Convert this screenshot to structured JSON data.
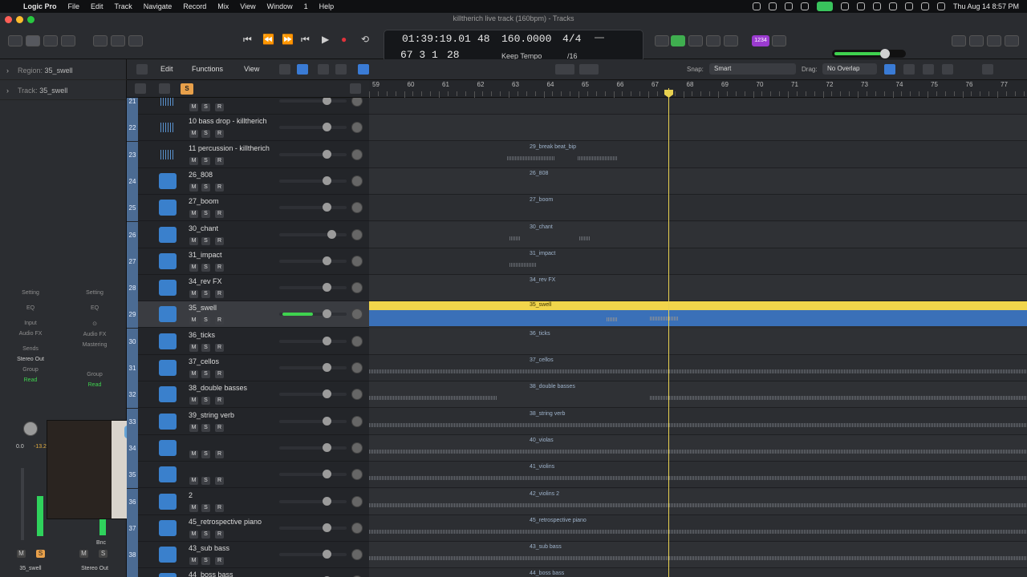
{
  "menubar": {
    "app": "Logic Pro",
    "items": [
      "File",
      "Edit",
      "Track",
      "Navigate",
      "Record",
      "Mix",
      "View",
      "Window",
      "1",
      "Help"
    ],
    "clock": "Thu Aug 14  8:57 PM"
  },
  "window": {
    "title": "killtherich live track (160bpm) - Tracks"
  },
  "lcd": {
    "time": "01:39:19.01",
    "bars": "67  3  1",
    "sub1": "48",
    "sub2": "28",
    "tempo": "160.0000",
    "tempo_mode": "Keep Tempo",
    "sig_top": "4/4",
    "sig_bot": "/16"
  },
  "toolbar": {
    "count_in": "1234"
  },
  "inspector": {
    "region_label": "Region:",
    "region_value": "35_swell",
    "track_label": "Track:",
    "track_value": "35_swell",
    "strip1": {
      "setting": "Setting",
      "eq": "EQ",
      "input": "Input",
      "audio_fx": "Audio FX",
      "sends": "Sends",
      "out": "Stereo Out",
      "group": "Group",
      "read": "Read",
      "vol": "0.0",
      "peak": "-13.2",
      "name": "35_swell"
    },
    "strip2": {
      "setting": "Setting",
      "eq": "EQ",
      "audio_fx": "Audio FX",
      "mastering": "Mastering",
      "group": "Group",
      "read": "Read",
      "bnc": "Bnc",
      "name": "Stereo Out"
    }
  },
  "arrange": {
    "edit": "Edit",
    "functions": "Functions",
    "view": "View",
    "snap_label": "Snap:",
    "snap": "Smart",
    "drag_label": "Drag:",
    "drag": "No Overlap"
  },
  "ruler": [
    "59",
    "60",
    "61",
    "62",
    "63",
    "64",
    "65",
    "66",
    "67",
    "68",
    "69",
    "70",
    "71",
    "72",
    "73",
    "74",
    "75",
    "76",
    "77"
  ],
  "tracks": [
    {
      "num": "21",
      "name": "",
      "region": ""
    },
    {
      "num": "22",
      "name": "10 bass drop - killtherich",
      "region": ""
    },
    {
      "num": "23",
      "name": "11 percussion - killtherich",
      "region": "29_break beat_bip"
    },
    {
      "num": "24",
      "name": "26_808",
      "region": "26_808"
    },
    {
      "num": "25",
      "name": "27_boom",
      "region": "27_boom"
    },
    {
      "num": "26",
      "name": "30_chant",
      "region": "30_chant"
    },
    {
      "num": "27",
      "name": "31_impact",
      "region": "31_impact"
    },
    {
      "num": "28",
      "name": "34_rev FX",
      "region": "34_rev FX"
    },
    {
      "num": "29",
      "name": "35_swell",
      "region": "35_swell"
    },
    {
      "num": "30",
      "name": "36_ticks",
      "region": "36_ticks"
    },
    {
      "num": "31",
      "name": "37_cellos",
      "region": "37_cellos"
    },
    {
      "num": "32",
      "name": "38_double basses",
      "region": "38_double basses"
    },
    {
      "num": "33",
      "name": "39_string verb",
      "region": "38_string verb"
    },
    {
      "num": "34",
      "name": "",
      "region": "40_violas"
    },
    {
      "num": "35",
      "name": "",
      "region": "41_violins"
    },
    {
      "num": "36",
      "name": "2",
      "region": "42_violins 2"
    },
    {
      "num": "37",
      "name": "45_retrospective piano",
      "region": "45_retrospective piano"
    },
    {
      "num": "38",
      "name": "43_sub bass",
      "region": "43_sub bass"
    },
    {
      "num": "39",
      "name": "44_boss bass",
      "region": "44_boss bass"
    }
  ],
  "mute": "M",
  "solo": "S",
  "rec": "R"
}
